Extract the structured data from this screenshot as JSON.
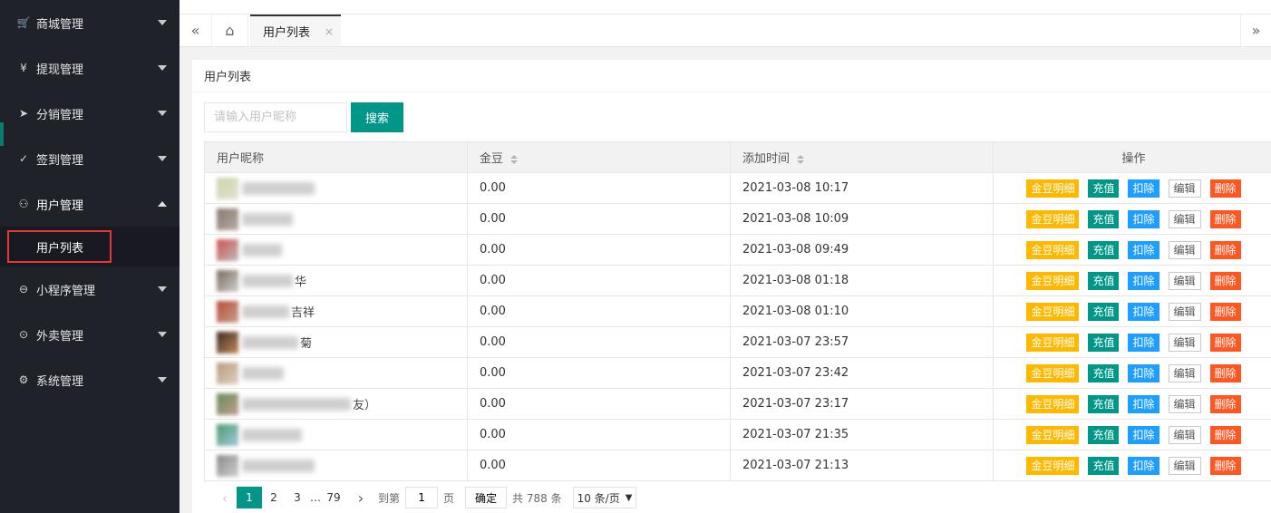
{
  "sidebar": {
    "items": [
      {
        "label": "商城管理",
        "icon": "cart-icon",
        "glyph": "🛒"
      },
      {
        "label": "提现管理",
        "icon": "yen-icon",
        "glyph": "¥"
      },
      {
        "label": "分销管理",
        "icon": "send-icon",
        "glyph": "➤"
      },
      {
        "label": "签到管理",
        "icon": "check-icon",
        "glyph": "✓"
      },
      {
        "label": "用户管理",
        "icon": "user-icon",
        "glyph": "⚇"
      },
      {
        "label": "小程序管理",
        "icon": "planet-icon",
        "glyph": "⊖"
      },
      {
        "label": "外卖管理",
        "icon": "location-icon",
        "glyph": "⊙"
      },
      {
        "label": "系统管理",
        "icon": "gear-icon",
        "glyph": "⚙"
      }
    ],
    "submenu_label": "用户列表"
  },
  "tabs": {
    "active_label": "用户列表",
    "close_glyph": "×",
    "left_glyph": "«",
    "home_glyph": "⌂",
    "right_glyph": "»"
  },
  "card": {
    "title": "用户列表",
    "search_placeholder": "请输入用户昵称",
    "search_button": "搜索"
  },
  "table": {
    "headers": {
      "nickname": "用户昵称",
      "gold": "金豆",
      "added": "添加时间",
      "actions": "操作"
    },
    "action_labels": {
      "detail": "金豆明细",
      "recharge": "充值",
      "deduct": "扣除",
      "edit": "编辑",
      "delete": "删除"
    },
    "rows": [
      {
        "nick_tail": "",
        "gold": "0.00",
        "time": "2021-03-08 10:17"
      },
      {
        "nick_tail": "",
        "gold": "0.00",
        "time": "2021-03-08 10:09"
      },
      {
        "nick_tail": "",
        "gold": "0.00",
        "time": "2021-03-08 09:49"
      },
      {
        "nick_tail": "华",
        "gold": "0.00",
        "time": "2021-03-08 01:18"
      },
      {
        "nick_tail": "吉祥",
        "gold": "0.00",
        "time": "2021-03-08 01:10"
      },
      {
        "nick_tail": "菊",
        "gold": "0.00",
        "time": "2021-03-07 23:57"
      },
      {
        "nick_tail": "",
        "gold": "0.00",
        "time": "2021-03-07 23:42"
      },
      {
        "nick_tail": "友）",
        "gold": "0.00",
        "time": "2021-03-07 23:17"
      },
      {
        "nick_tail": "",
        "gold": "0.00",
        "time": "2021-03-07 21:35"
      },
      {
        "nick_tail": "",
        "gold": "0.00",
        "time": "2021-03-07 21:13"
      }
    ]
  },
  "pager": {
    "prev": "‹",
    "pages": [
      "1",
      "2",
      "3"
    ],
    "ellipsis": "…",
    "last": "79",
    "next": "›",
    "goto_label": "到第",
    "goto_value": "1",
    "page_unit": "页",
    "confirm": "确定",
    "total": "共 788 条",
    "page_size": "10 条/页",
    "dropdown_glyph": "▼"
  }
}
